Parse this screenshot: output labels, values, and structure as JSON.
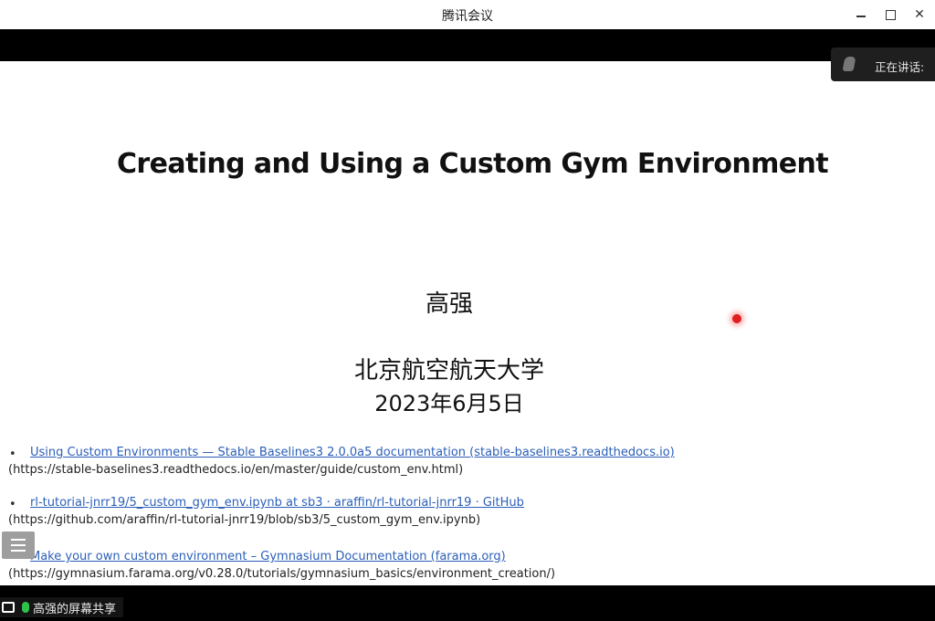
{
  "window": {
    "title": "腾讯会议",
    "minimize_icon": "minimize-icon",
    "maximize_icon": "maximize-icon",
    "close_label": "✕"
  },
  "speaking": {
    "label": "正在讲话:"
  },
  "slide": {
    "title": "Creating and Using a Custom Gym Environment",
    "author": "高强",
    "university": "北京航空航天大学",
    "date": "2023年6月5日",
    "references": [
      {
        "bullet": "•",
        "link_text": "Using Custom Environments — Stable Baselines3 2.0.0a5 documentation (stable-baselines3.readthedocs.io)",
        "url_text": "(https://stable-baselines3.readthedocs.io/en/master/guide/custom_env.html)"
      },
      {
        "bullet": "•",
        "link_text": "rl-tutorial-jnrr19/5_custom_gym_env.ipynb at sb3 · araffin/rl-tutorial-jnrr19 · GitHub",
        "url_text": "(https://github.com/araffin/rl-tutorial-jnrr19/blob/sb3/5_custom_gym_env.ipynb)"
      },
      {
        "bullet": "•",
        "link_text": "Make your own custom environment – Gymnasium Documentation (farama.org)",
        "url_text": "(https://gymnasium.farama.org/v0.28.0/tutorials/gymnasium_basics/environment_creation/)"
      }
    ]
  },
  "share": {
    "label": "高强的屏幕共享"
  }
}
